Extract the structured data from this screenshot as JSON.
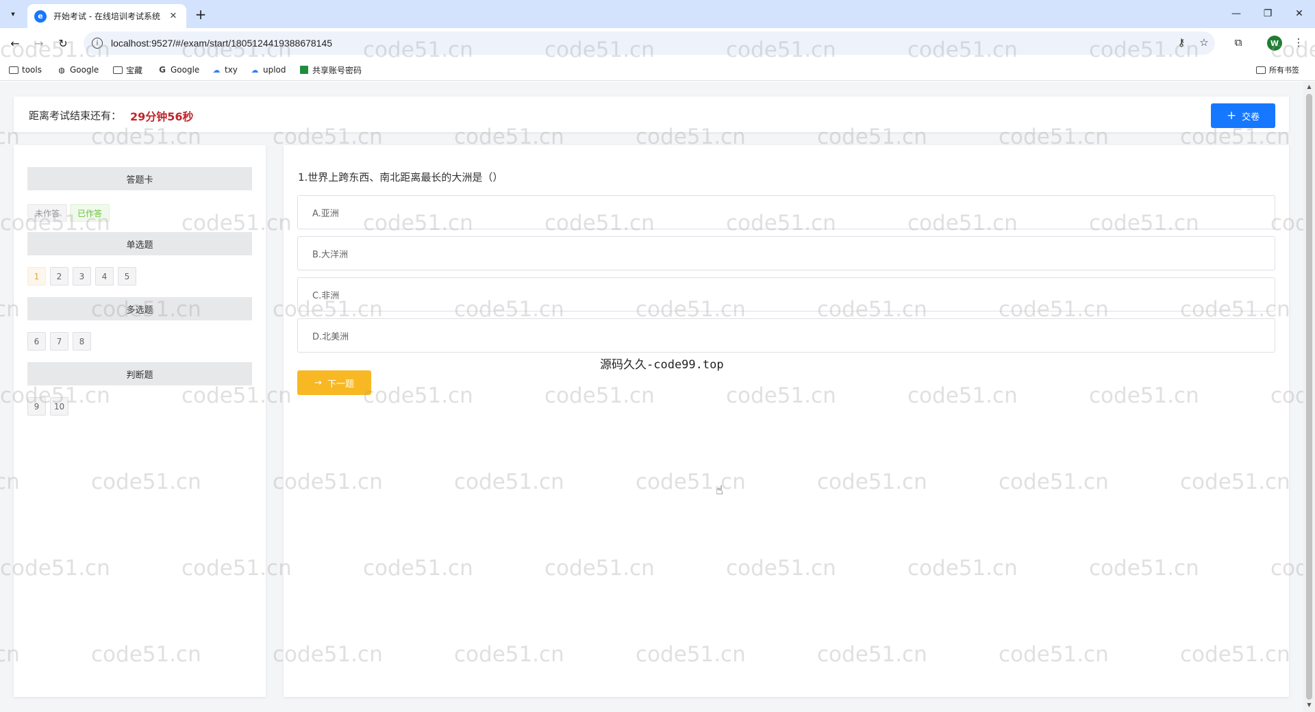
{
  "browser": {
    "tab_title": "开始考试 - 在线培训考试系统",
    "url": "localhost:9527/#/exam/start/1805124419388678145",
    "profile_initial": "W",
    "bookmarks": [
      {
        "label": "tools",
        "icon": "folder-icon"
      },
      {
        "label": "Google",
        "icon": "globe-icon"
      },
      {
        "label": "宝藏",
        "icon": "folder-icon"
      },
      {
        "label": "Google",
        "icon": "google-icon"
      },
      {
        "label": "txy",
        "icon": "cloud-icon"
      },
      {
        "label": "uplod",
        "icon": "cloud-icon"
      },
      {
        "label": "共享账号密码",
        "icon": "sheets-icon"
      }
    ],
    "all_bookmarks_label": "所有书签"
  },
  "exam": {
    "timer_label": "距离考试结束还有：",
    "timer_value": "29分钟56秒",
    "submit_label": "交卷",
    "answer_card_title": "答题卡",
    "legend_unanswered": "未作答",
    "legend_answered": "已作答",
    "sections": [
      {
        "title": "单选题",
        "numbers": [
          "1",
          "2",
          "3",
          "4",
          "5"
        ],
        "current": "1"
      },
      {
        "title": "多选题",
        "numbers": [
          "6",
          "7",
          "8"
        ]
      },
      {
        "title": "判断题",
        "numbers": [
          "9",
          "10"
        ]
      }
    ],
    "question": "1.世界上跨东西、南北距离最长的大洲是（）",
    "options": [
      "A.亚洲",
      "B.大洋洲",
      "C.非洲",
      "D.北美洲"
    ],
    "next_label": "下一题"
  },
  "watermark_text": "code51.cn",
  "caption": "源码久久-code99.top",
  "colors": {
    "primary": "#1677ff",
    "timer_red": "#c0252a",
    "next_yellow": "#f7b824",
    "answered_green": "#67c23a"
  }
}
